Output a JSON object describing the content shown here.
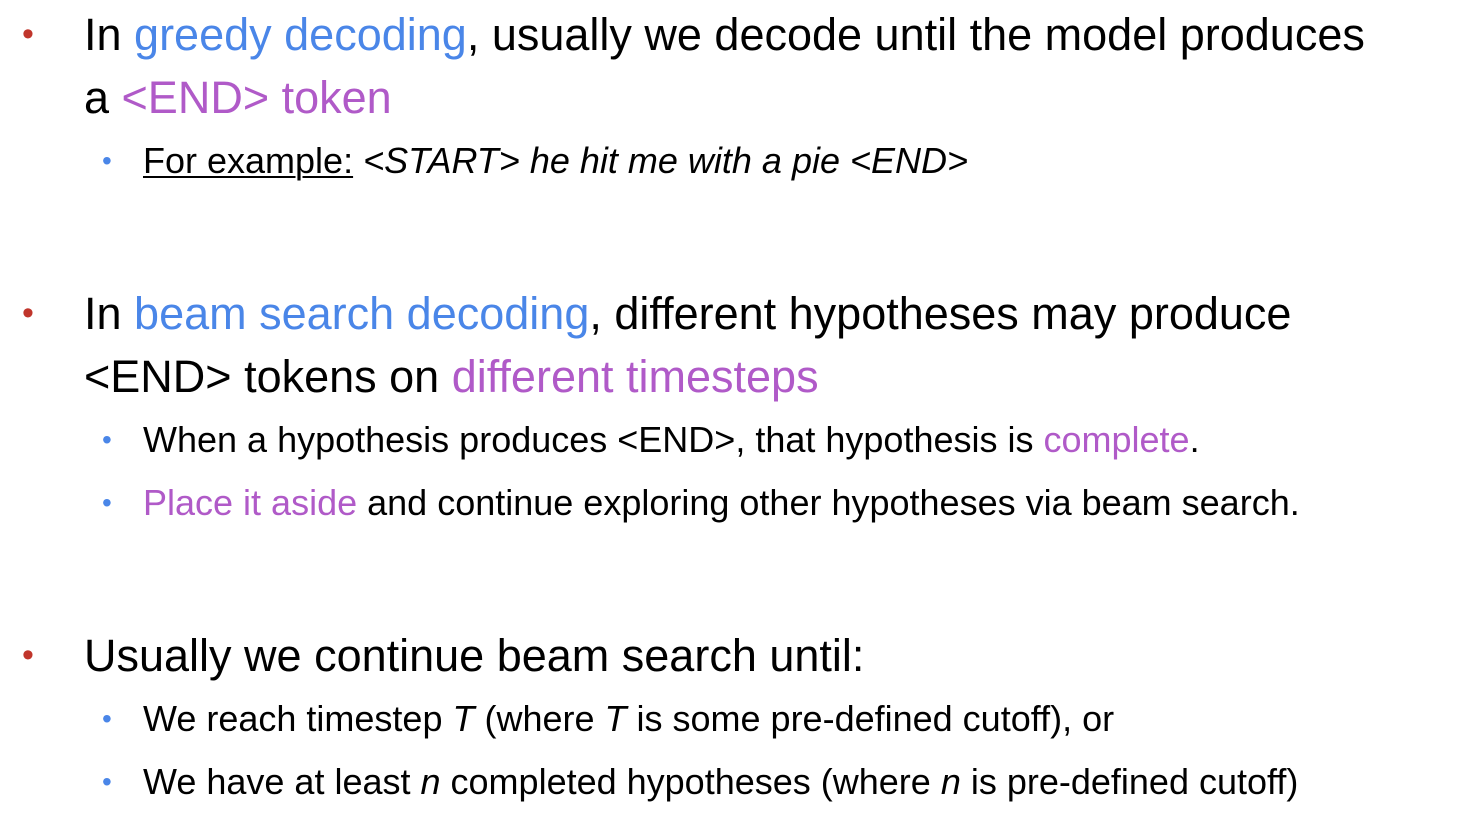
{
  "colors": {
    "bullet_l1": "#c0352b",
    "bullet_l2": "#4a86e8",
    "highlight_blue": "#4a86e8",
    "highlight_purple": "#b05ac8",
    "text": "#000000"
  },
  "bullet_glyph": "•",
  "point1": {
    "pre": "In ",
    "term": "greedy decoding",
    "mid": ", usually we decode until the model produces",
    "line2_pre": "a ",
    "line2_term": "<END> token",
    "sub1": {
      "label": "For example:",
      "example": "<START> he hit me with a pie <END>"
    }
  },
  "point2": {
    "pre": "In ",
    "term": "beam search decoding",
    "mid": ", different hypotheses may produce",
    "line2_pre": "<END> tokens on ",
    "line2_term": "different timesteps",
    "sub1": {
      "pre": "When a hypothesis produces <END>, that hypothesis is ",
      "term": "complete",
      "post": "."
    },
    "sub2": {
      "term": "Place it aside",
      "post": " and continue exploring other hypotheses via beam search."
    }
  },
  "point3": {
    "text": "Usually we continue beam search until:",
    "sub1": {
      "pre": "We reach timestep ",
      "var1": "T",
      "mid": " (where ",
      "var2": "T",
      "post": " is some pre-defined cutoff), or"
    },
    "sub2": {
      "pre": "We have at least ",
      "var1": "n",
      "mid": " completed hypotheses (where ",
      "var2": "n",
      "post": " is pre-defined cutoff)"
    }
  }
}
